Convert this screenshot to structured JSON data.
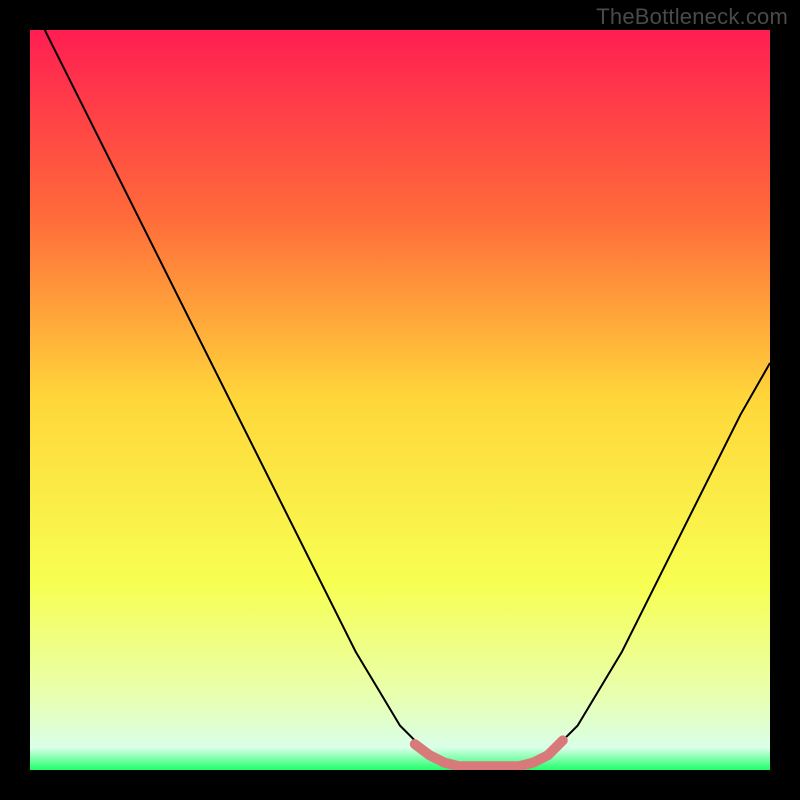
{
  "watermark": "TheBottleneck.com",
  "chart_data": {
    "type": "line",
    "title": "",
    "xlabel": "",
    "ylabel": "",
    "xlim": [
      0,
      100
    ],
    "ylim": [
      0,
      100
    ],
    "gradient_stops": [
      {
        "offset": 0.0,
        "color": "#ff1e52"
      },
      {
        "offset": 0.25,
        "color": "#ff6a3a"
      },
      {
        "offset": 0.5,
        "color": "#ffd73a"
      },
      {
        "offset": 0.75,
        "color": "#f7ff52"
      },
      {
        "offset": 0.9,
        "color": "#e8ffb0"
      },
      {
        "offset": 0.97,
        "color": "#d9ffe8"
      },
      {
        "offset": 1.0,
        "color": "#1fff6a"
      }
    ],
    "series": [
      {
        "name": "bottleneck-curve",
        "stroke": "#000000",
        "stroke_width": 2,
        "points": [
          {
            "x": 2,
            "y": 100
          },
          {
            "x": 6,
            "y": 92
          },
          {
            "x": 12,
            "y": 80
          },
          {
            "x": 20,
            "y": 64
          },
          {
            "x": 28,
            "y": 48
          },
          {
            "x": 36,
            "y": 32
          },
          {
            "x": 44,
            "y": 16
          },
          {
            "x": 50,
            "y": 6
          },
          {
            "x": 54,
            "y": 2
          },
          {
            "x": 58,
            "y": 0.5
          },
          {
            "x": 62,
            "y": 0.5
          },
          {
            "x": 66,
            "y": 0.5
          },
          {
            "x": 70,
            "y": 2
          },
          {
            "x": 74,
            "y": 6
          },
          {
            "x": 80,
            "y": 16
          },
          {
            "x": 88,
            "y": 32
          },
          {
            "x": 96,
            "y": 48
          },
          {
            "x": 100,
            "y": 55
          }
        ]
      },
      {
        "name": "highlight-band",
        "stroke": "#d87a7a",
        "stroke_width": 10,
        "points": [
          {
            "x": 52,
            "y": 3.5
          },
          {
            "x": 54,
            "y": 2
          },
          {
            "x": 56,
            "y": 1
          },
          {
            "x": 58,
            "y": 0.5
          },
          {
            "x": 60,
            "y": 0.5
          },
          {
            "x": 62,
            "y": 0.5
          },
          {
            "x": 64,
            "y": 0.5
          },
          {
            "x": 66,
            "y": 0.5
          },
          {
            "x": 68,
            "y": 1
          },
          {
            "x": 70,
            "y": 2
          },
          {
            "x": 72,
            "y": 4
          }
        ]
      }
    ]
  }
}
